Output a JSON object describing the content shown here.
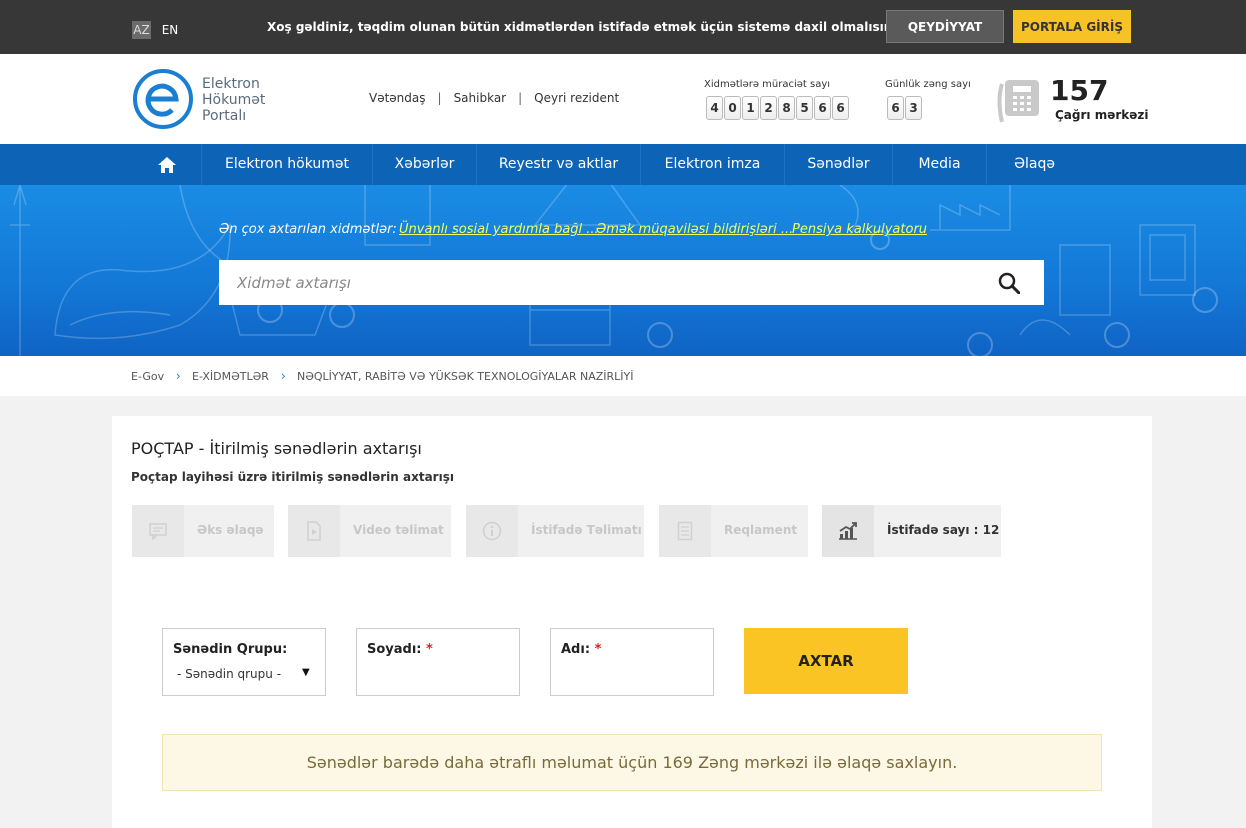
{
  "topbar": {
    "languages": [
      "AZ",
      "EN"
    ],
    "welcome": "Xoş gəldiniz, təqdim olunan bütün xidmətlərdən istifadə etmək üçün sistemə daxil olmalısınız",
    "register_label": "QEYDİYYAT",
    "login_label": "PORTALA GİRİŞ"
  },
  "header": {
    "logo_lines": [
      "Elektron",
      "Hökumət",
      "Portalı"
    ],
    "user_links": [
      "Vətəndaş",
      "Sahibkar",
      "Qeyri rezident"
    ],
    "service_counter_label": "Xidmətlərə müraciət sayı",
    "service_counter_digits": [
      "4",
      "0",
      "1",
      "2",
      "8",
      "5",
      "6",
      "6"
    ],
    "call_counter_label": "Günlük zəng sayı",
    "call_counter_digits": [
      "6",
      "3"
    ],
    "call_center_number": "157",
    "call_center_label": "Çağrı mərkəzi"
  },
  "nav": {
    "items": [
      "Elektron hökumət",
      "Xəbərlər",
      "Reyestr və aktlar",
      "Elektron imza",
      "Sənədlər",
      "Media",
      "Əlaqə"
    ]
  },
  "hero": {
    "popular_label": "Ən çox axtarılan xidmətlər:",
    "popular_links": [
      "Ünvanlı sosial yardımla bağl ...",
      "Əmək müqaviləsi bildirişləri ...",
      "Pensiya kalkulyatoru"
    ],
    "search_placeholder": "Xidmət axtarışı"
  },
  "breadcrumb": [
    "E-Gov",
    "E-XİDMƏTLƏR",
    "NƏQLİYYAT, RABİTƏ VƏ YÜKSƏK TEXNOLOGİYALAR NAZİRLİYİ"
  ],
  "service": {
    "title": "POÇTAP - İtirilmiş sənədlərin axtarışı",
    "subtitle": "Poçtap layihəsi üzrə itirilmiş sənədlərin axtarışı",
    "tiles": [
      "Əks əlaqə",
      "Video təlimat",
      "İstifadə Təlimatı",
      "Reqlament",
      "İstifadə sayı : 12"
    ]
  },
  "form": {
    "group_label": "Sənədin Qrupu:",
    "group_value": "- Sənədin qrupu -",
    "surname_label": "Soyadı:",
    "name_label": "Adı:",
    "required_mark": "*",
    "search_button": "AXTAR"
  },
  "notice": "Sənədlər barədə daha ətraflı məlumat üçün 169 Zəng mərkəzi ilə əlaqə saxlayın.",
  "colors": {
    "topbar": "#373737",
    "accent_yellow": "#f7c226",
    "nav_blue": "#0d64b6",
    "link_yellow": "#f2ff5e"
  }
}
